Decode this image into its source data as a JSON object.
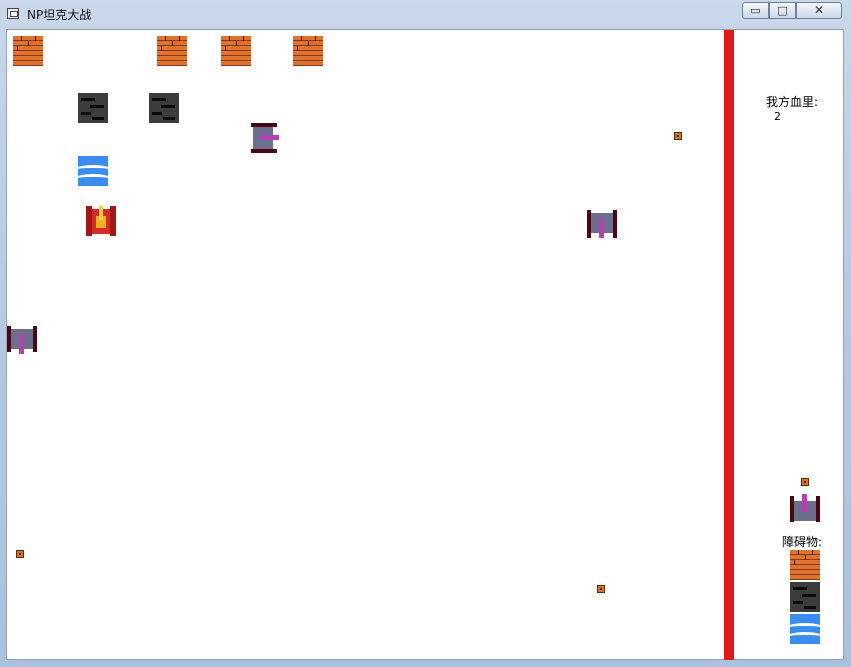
{
  "window": {
    "title": "NP坦克大战",
    "controls": {
      "minimize": "▭",
      "maximize": "□",
      "close": "✕"
    }
  },
  "hud": {
    "health_label": "我方血里:",
    "health_value": "2",
    "obstacles_label": "障碍物:"
  },
  "colors": {
    "wall": "#e61919",
    "brick": "#e0722f",
    "steel": "#3c3c3c",
    "water": "#3a8cf0",
    "enemy_tank": "#6c6f8c",
    "player_tank": "#d42a2a"
  }
}
